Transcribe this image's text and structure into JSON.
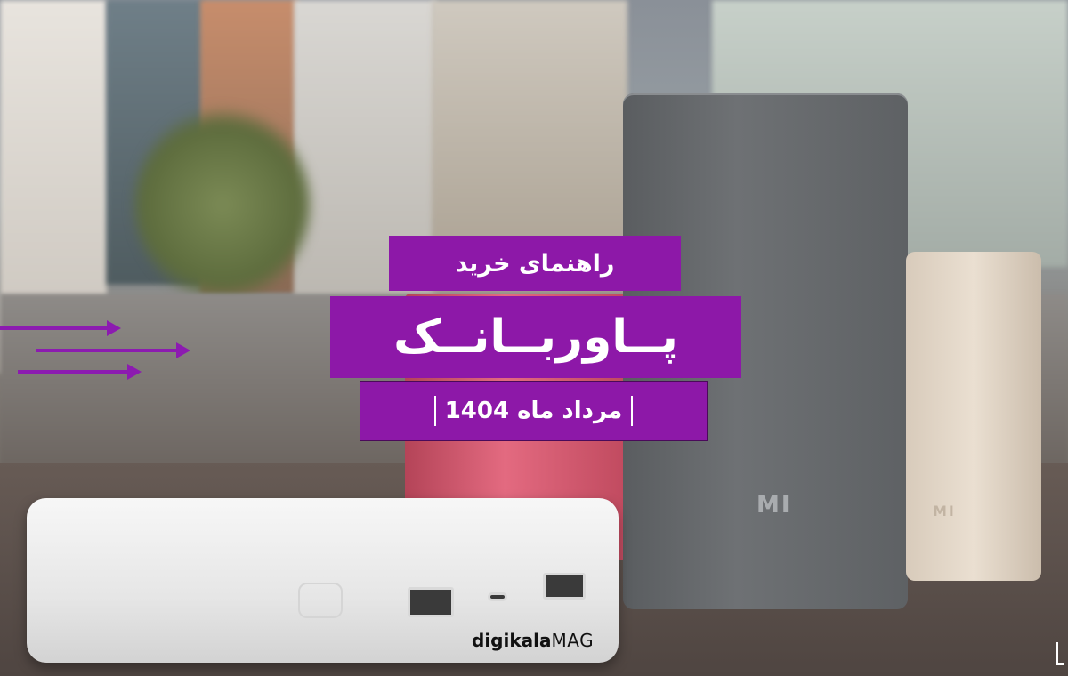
{
  "banner": {
    "top_label": "راهنمای خرید",
    "main_title": "پــاوربــانــک",
    "date_label": "مرداد ماه 1404"
  },
  "products": {
    "logo_text": "MI"
  },
  "brand": {
    "name_bold": "digikala",
    "name_suffix": "MAG"
  },
  "colors": {
    "accent": "#8d18a8",
    "arrow": "#8c1bb0"
  }
}
